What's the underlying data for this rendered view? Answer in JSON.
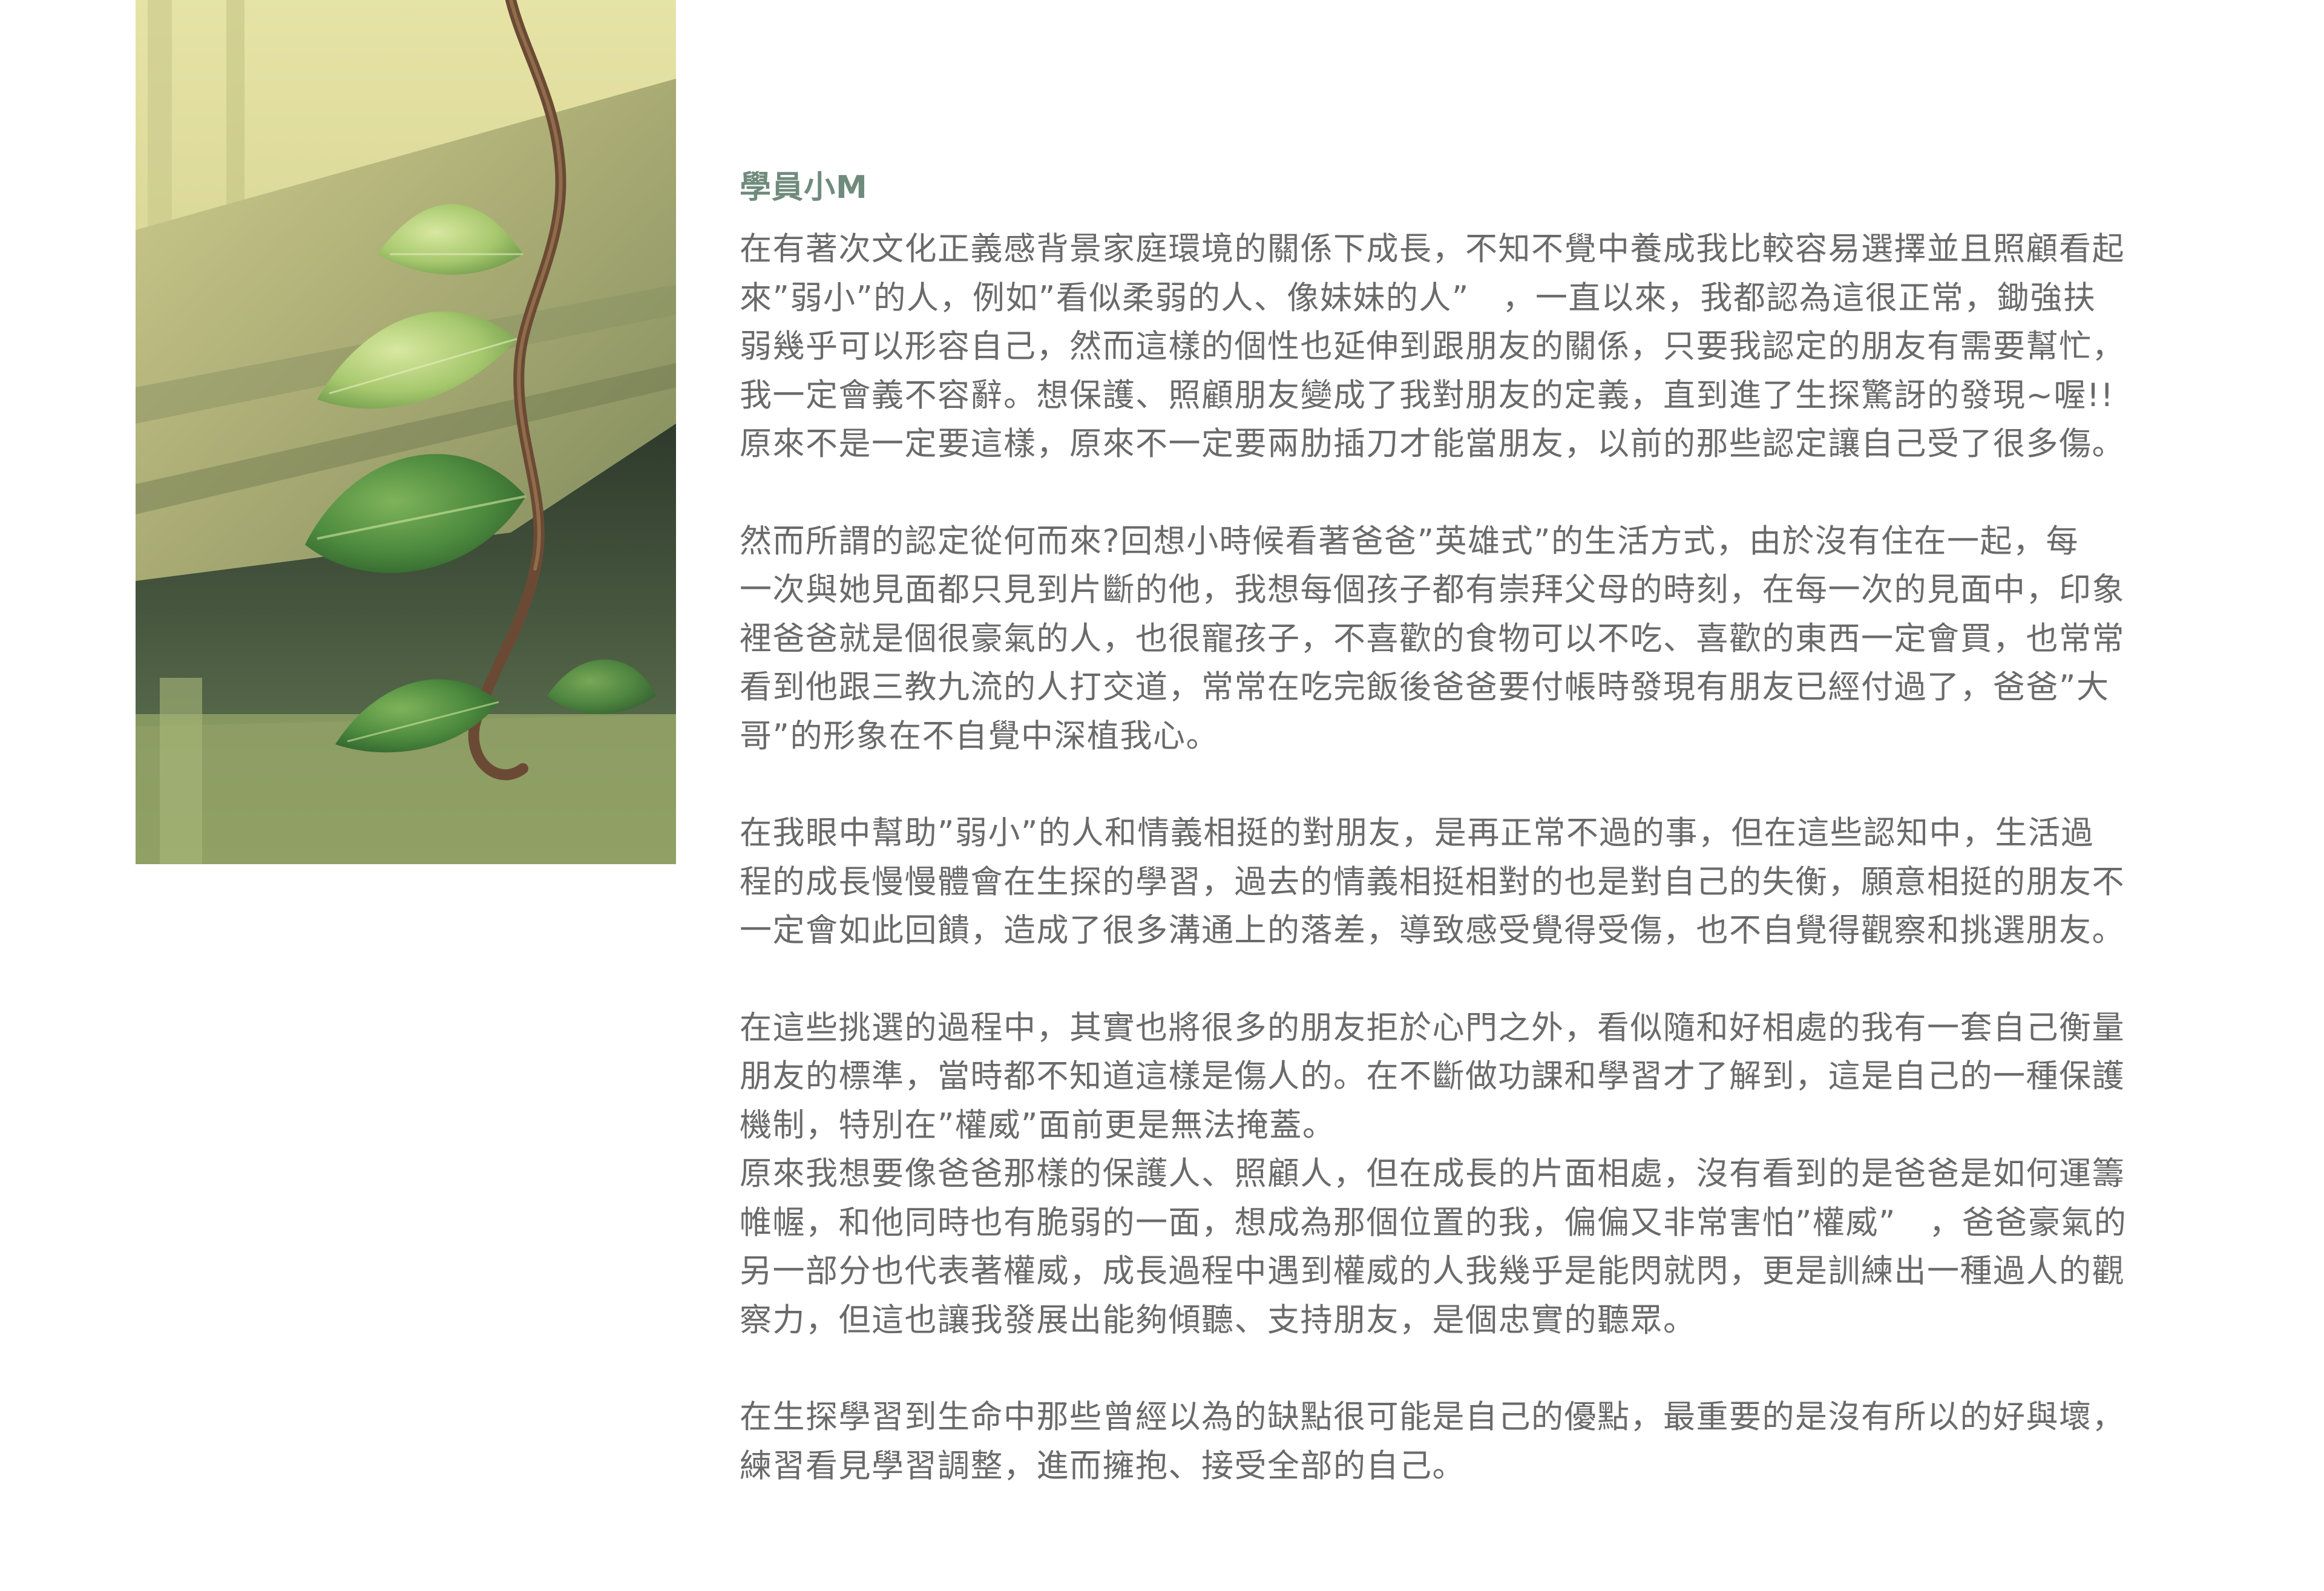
{
  "photo": {
    "icon": "vine-leaves-on-wooden-fence-photo",
    "colors": {
      "background_light": "#e8e4a8",
      "background_mid": "#c9c688",
      "wood_dark": "#3d4a36",
      "leaf_green": "#3f7a3a",
      "leaf_light": "#8fbf5a",
      "vine_brown": "#6b4a35"
    }
  },
  "article": {
    "author": "學員小M",
    "paragraphs": [
      {
        "lines": [
          "在有著次文化正義感背景家庭環境的關係下成長，不知不覺中養成我比較容易選擇並且照顧看起",
          "來”弱小”的人，例如”看似柔弱的人、像妹妹的人”　，一直以來，我都認為這很正常，鋤強扶",
          "弱幾乎可以形容自己，然而這樣的個性也延伸到跟朋友的關係，只要我認定的朋友有需要幫忙，",
          "我一定會義不容辭。想保護、照顧朋友變成了我對朋友的定義，直到進了生探驚訝的發現~喔!!",
          "原來不是一定要這樣，原來不一定要兩肋插刀才能當朋友，以前的那些認定讓自己受了很多傷。"
        ]
      },
      {
        "lines": [
          "然而所謂的認定從何而來?回想小時候看著爸爸”英雄式”的生活方式，由於沒有住在一起，每",
          "一次與她見面都只見到片斷的他，我想每個孩子都有崇拜父母的時刻，在每一次的見面中，印象",
          "裡爸爸就是個很豪氣的人，也很寵孩子，不喜歡的食物可以不吃、喜歡的東西一定會買，也常常",
          "看到他跟三教九流的人打交道，常常在吃完飯後爸爸要付帳時發現有朋友已經付過了，爸爸”大",
          "哥”的形象在不自覺中深植我心。"
        ]
      },
      {
        "lines": [
          "在我眼中幫助”弱小”的人和情義相挺的對朋友，是再正常不過的事，但在這些認知中，生活過",
          "程的成長慢慢體會在生探的學習，過去的情義相挺相對的也是對自己的失衡，願意相挺的朋友不",
          "一定會如此回饋，造成了很多溝通上的落差，導致感受覺得受傷，也不自覺得觀察和挑選朋友。"
        ]
      },
      {
        "lines": [
          "在這些挑選的過程中，其實也將很多的朋友拒於心門之外，看似隨和好相處的我有一套自己衡量",
          "朋友的標準，當時都不知道這樣是傷人的。在不斷做功課和學習才了解到，這是自己的一種保護",
          "機制，特別在”權威”面前更是無法掩蓋。"
        ]
      },
      {
        "lines": [
          "原來我想要像爸爸那樣的保護人、照顧人，但在成長的片面相處，沒有看到的是爸爸是如何運籌",
          "帷幄，和他同時也有脆弱的一面，想成為那個位置的我，偏偏又非常害怕”權威”　，爸爸豪氣的",
          "另一部分也代表著權威，成長過程中遇到權威的人我幾乎是能閃就閃，更是訓練出一種過人的觀",
          "察力，但這也讓我發展出能夠傾聽、支持朋友，是個忠實的聽眾。"
        ]
      },
      {
        "lines": [
          "在生探學習到生命中那些曾經以為的缺點很可能是自己的優點，最重要的是沒有所以的好與壞，",
          "練習看見學習調整，進而擁抱、接受全部的自己。"
        ]
      }
    ]
  }
}
